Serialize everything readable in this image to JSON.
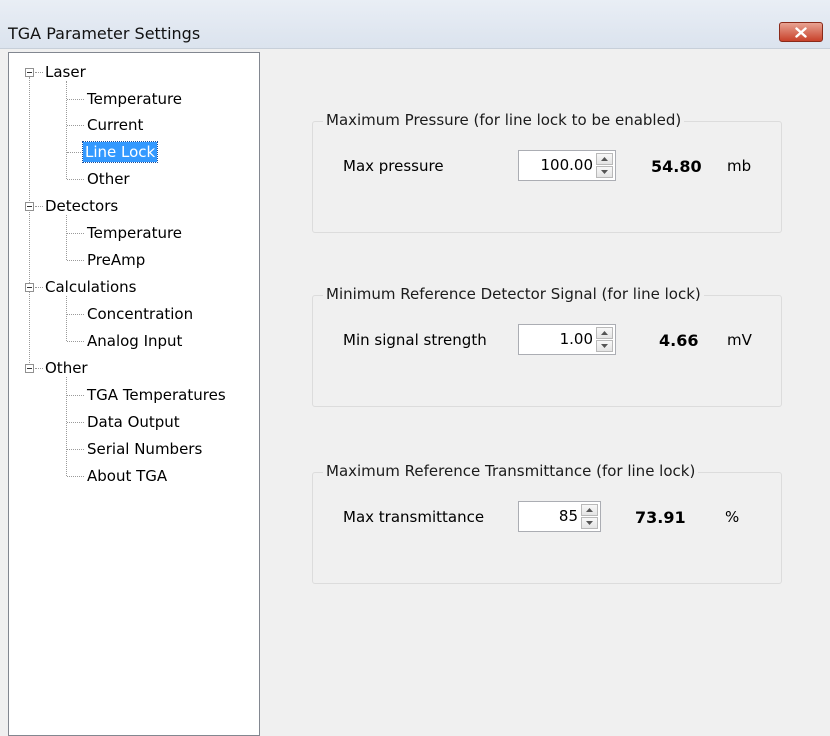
{
  "window": {
    "title": "TGA Parameter Settings"
  },
  "tree": {
    "groups": [
      {
        "label": "Laser",
        "children": [
          "Temperature",
          "Current",
          "Line Lock",
          "Other"
        ]
      },
      {
        "label": "Detectors",
        "children": [
          "Temperature",
          "PreAmp"
        ]
      },
      {
        "label": "Calculations",
        "children": [
          "Concentration",
          "Analog Input"
        ]
      },
      {
        "label": "Other",
        "children": [
          "TGA Temperatures",
          "Data Output",
          "Serial Numbers",
          "About TGA"
        ]
      }
    ],
    "selected": "Line Lock"
  },
  "sections": [
    {
      "title": "Maximum Pressure (for line lock to be enabled)",
      "label": "Max pressure",
      "value": "100.00",
      "reading": "54.80",
      "unit": "mb"
    },
    {
      "title": "Minimum Reference Detector Signal (for line lock)",
      "label": "Min signal strength",
      "value": "1.00",
      "reading": "4.66",
      "unit": "mV"
    },
    {
      "title": "Maximum Reference Transmittance (for line lock)",
      "label": "Max transmittance",
      "value": "85",
      "reading": "73.91",
      "unit": "%"
    }
  ],
  "icons": {
    "close": "close-icon",
    "expander": "collapse-minus-icon",
    "spin_up": "spin-up-icon",
    "spin_down": "spin-down-icon"
  },
  "colors": {
    "selection": "#3399ff",
    "close_button": "#c8412a"
  }
}
